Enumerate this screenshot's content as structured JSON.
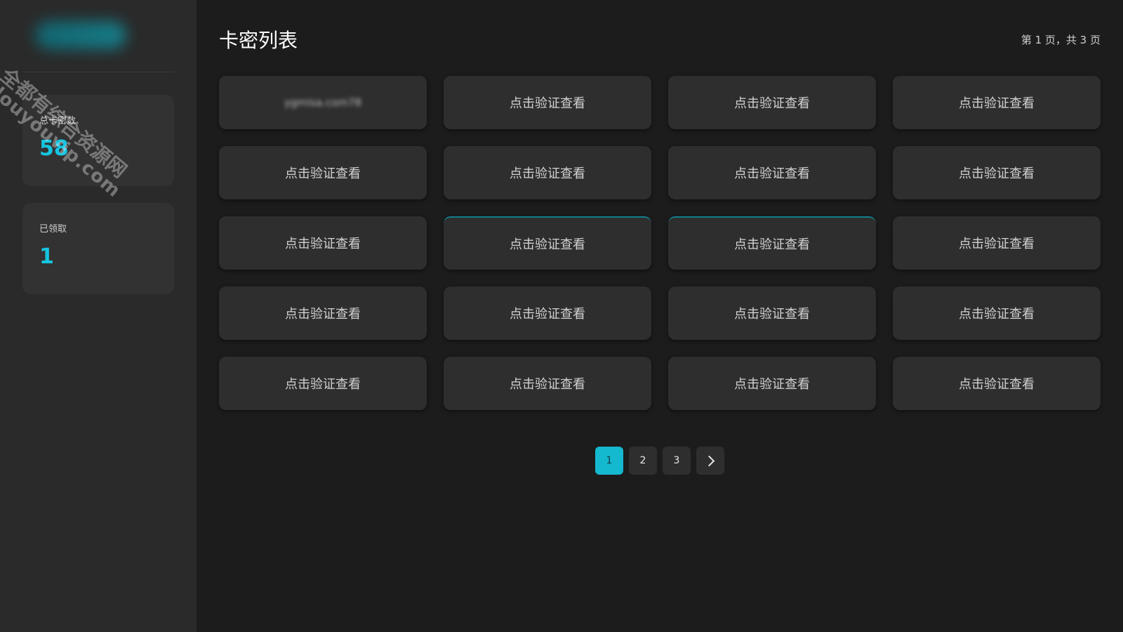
{
  "sidebar": {
    "stats": [
      {
        "label": "总卡密数",
        "value": "58"
      },
      {
        "label": "已领取",
        "value": "1"
      }
    ]
  },
  "header": {
    "title": "卡密列表",
    "page_info": "第 1 页，共 3 页"
  },
  "cards": [
    {
      "label": "ygmisa.com78",
      "revealed": true
    },
    {
      "label": "点击验证查看"
    },
    {
      "label": "点击验证查看"
    },
    {
      "label": "点击验证查看"
    },
    {
      "label": "点击验证查看"
    },
    {
      "label": "点击验证查看"
    },
    {
      "label": "点击验证查看"
    },
    {
      "label": "点击验证查看"
    },
    {
      "label": "点击验证查看"
    },
    {
      "label": "点击验证查看"
    },
    {
      "label": "点击验证查看"
    },
    {
      "label": "点击验证查看"
    },
    {
      "label": "点击验证查看"
    },
    {
      "label": "点击验证查看"
    },
    {
      "label": "点击验证查看"
    },
    {
      "label": "点击验证查看"
    },
    {
      "label": "点击验证查看"
    },
    {
      "label": "点击验证查看"
    },
    {
      "label": "点击验证查看"
    },
    {
      "label": "点击验证查看"
    }
  ],
  "pagination": {
    "pages": [
      "1",
      "2",
      "3"
    ],
    "current": "1",
    "next_icon": "chevron-right-icon"
  },
  "watermark": {
    "line1": "全都有综合资源网",
    "line2": "douyouvip.com"
  },
  "colors": {
    "accent": "#14b8cf",
    "background": "#1c1c1c",
    "sidebar": "#2a2a2a",
    "card": "#2e2e2e"
  }
}
